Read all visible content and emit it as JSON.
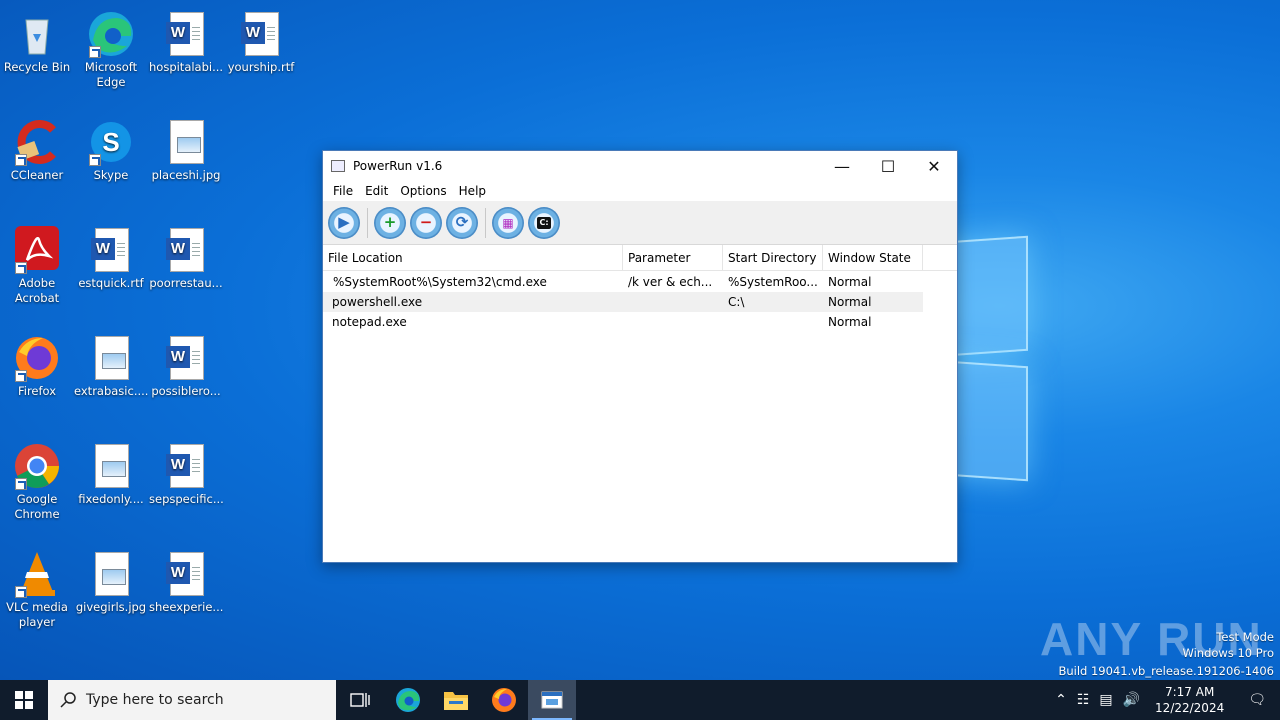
{
  "desktop": {
    "icons": [
      {
        "label": "Recycle Bin"
      },
      {
        "label": "Microsoft Edge"
      },
      {
        "label": "hospitalabi..."
      },
      {
        "label": "yourship.rtf"
      },
      {
        "label": "CCleaner"
      },
      {
        "label": "Skype"
      },
      {
        "label": "placeshi.jpg"
      },
      {
        "label": "Adobe Acrobat"
      },
      {
        "label": "estquick.rtf"
      },
      {
        "label": "poorrestau..."
      },
      {
        "label": "Firefox"
      },
      {
        "label": "extrabasic...."
      },
      {
        "label": "possiblero..."
      },
      {
        "label": "Google Chrome"
      },
      {
        "label": "fixedonly...."
      },
      {
        "label": "sepspecific..."
      },
      {
        "label": "VLC media player"
      },
      {
        "label": "givegirls.jpg"
      },
      {
        "label": "sheexperie..."
      }
    ]
  },
  "window": {
    "title": "PowerRun v1.6",
    "menu": [
      "File",
      "Edit",
      "Options",
      "Help"
    ],
    "columns": [
      "File Location",
      "Parameter",
      "Start Directory",
      "Window State"
    ],
    "rows": [
      {
        "file": "%SystemRoot%\\System32\\cmd.exe",
        "param": "/k ver & ech...",
        "dir": "%SystemRoo...",
        "state": "Normal"
      },
      {
        "file": "powershell.exe",
        "param": "",
        "dir": "C:\\",
        "state": "Normal"
      },
      {
        "file": "notepad.exe",
        "param": "",
        "dir": "",
        "state": "Normal"
      }
    ]
  },
  "watermark": {
    "line1": "Test Mode",
    "line2": "Windows 10 Pro",
    "line3": "Build 19041.vb_release.191206-1406",
    "brand": "ANY RUN"
  },
  "taskbar": {
    "search_placeholder": "Type here to search",
    "time": "7:17 AM",
    "date": "12/22/2024"
  }
}
